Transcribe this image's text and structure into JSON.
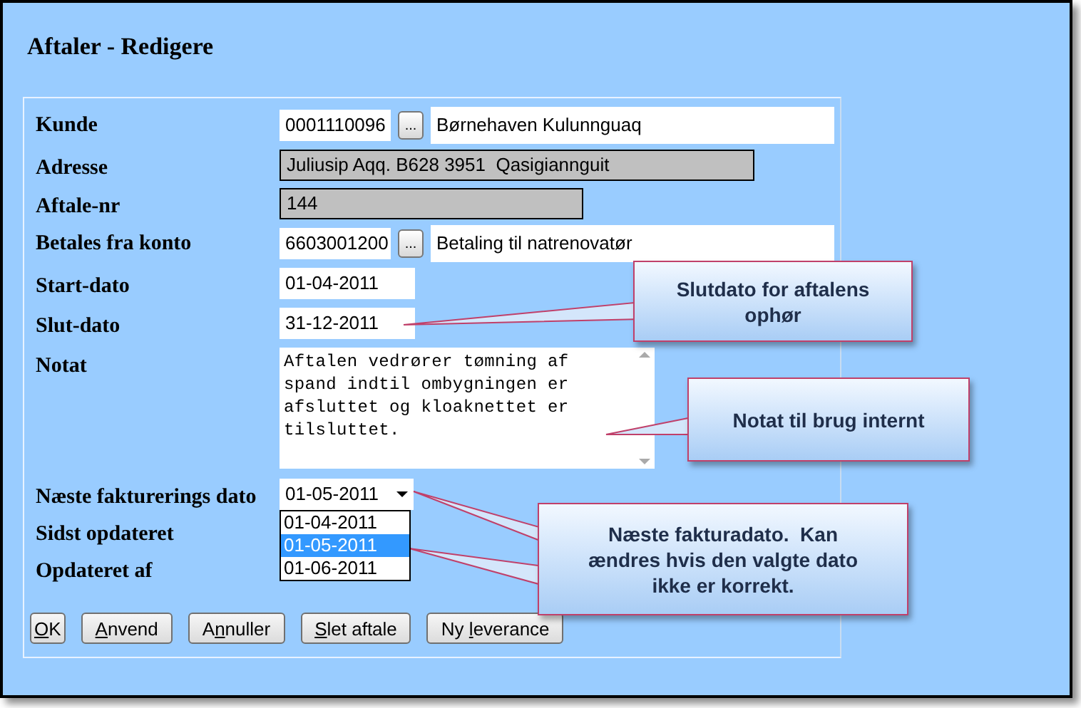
{
  "title": "Aftaler - Redigere",
  "fields": [
    {
      "kind": "lookup",
      "label": "Kunde",
      "value": "0001110096",
      "button": "...",
      "description": "Børnehaven Kulunnguaq"
    },
    {
      "kind": "wide",
      "label": "Adresse",
      "value": "Juliusip Aqq. B628 3951  Qasigiannguit"
    },
    {
      "kind": "readonly",
      "label": "Aftale-nr",
      "value": "144"
    },
    {
      "kind": "lookup",
      "label": "Betales fra konto",
      "value": "6603001200",
      "button": "...",
      "description": "Betaling til natrenovatør"
    },
    {
      "kind": "text",
      "label": "Start-dato",
      "value": "01-04-2011"
    },
    {
      "kind": "text",
      "label": "Slut-dato",
      "value": "31-12-2011"
    },
    {
      "kind": "textarea",
      "label": "Notat",
      "value": "Aftalen vedrører tømning af spand indtil ombygningen er afsluttet og kloaknettet er tilsluttet."
    },
    {
      "kind": "select",
      "label": "Næste fakturerings dato",
      "value": "01-05-2011",
      "expanded": true,
      "options": [
        {
          "label": "01-04-2011",
          "selected": false
        },
        {
          "label": "01-05-2011",
          "selected": true
        },
        {
          "label": "01-06-2011",
          "selected": false
        }
      ]
    },
    {
      "kind": "info",
      "label": "Sidst opdateret"
    },
    {
      "kind": "info",
      "label": "Opdateret af"
    }
  ],
  "buttons": [
    {
      "key": "O",
      "post": "K"
    },
    {
      "key": "A",
      "post": "nvend"
    },
    {
      "pre": "A",
      "key": "n",
      "post": "nuller"
    },
    {
      "key": "S",
      "post": "let aftale"
    },
    {
      "pre": "Ny ",
      "key": "l",
      "post": "everance"
    }
  ],
  "callouts": [
    {
      "text": "Slutdato for aftalens ophør"
    },
    {
      "text": "Notat til brug internt"
    },
    {
      "text": "Næste fakturadato.  Kan ændres hvis den valgte dato ikke er korrekt."
    }
  ]
}
